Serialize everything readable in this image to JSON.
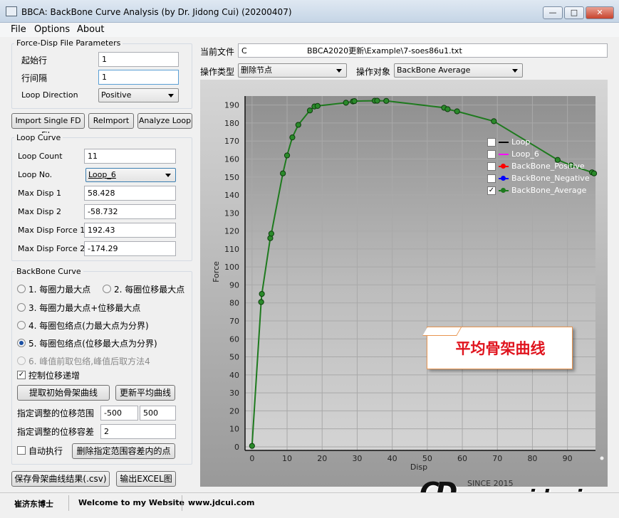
{
  "window": {
    "title": "BBCA: BackBone Curve Analysis (by Dr. Jidong Cui) (20200407)",
    "min": "—",
    "max": "□",
    "close": "✕"
  },
  "menu": [
    "File",
    "Options",
    "About"
  ],
  "fd_params": {
    "title": "Force-Disp File Parameters",
    "start_row_label": "起始行",
    "start_row": "1",
    "row_interval_label": "行间隔",
    "row_interval": "1",
    "loop_direction_label": "Loop Direction",
    "loop_direction": "Positive"
  },
  "buttons": {
    "import": "Import Single FD File",
    "reimport": "ReImport",
    "analyze": "Analyze Loop"
  },
  "loop_curve": {
    "title": "Loop Curve",
    "loop_count_label": "Loop Count",
    "loop_count": "11",
    "loop_no_label": "Loop No.",
    "loop_no": "Loop_6",
    "max_disp1_label": "Max Disp 1",
    "max_disp1": "58.428",
    "max_disp2_label": "Max Disp 2",
    "max_disp2": "-58.732",
    "max_force1_label": "Max Disp Force 1",
    "max_force1": "192.43",
    "max_force2_label": "Max Disp Force 2",
    "max_force2": "-174.29"
  },
  "backbone": {
    "title": "BackBone Curve",
    "opt1": "1. 每圈力最大点",
    "opt2": "2. 每圈位移最大点",
    "opt3": "3. 每圈力最大点+位移最大点",
    "opt4": "4. 每圈包络点(力最大点为分界)",
    "opt5": "5. 每圈包络点(位移最大点为分界)",
    "opt6": "6. 峰值前取包络,峰值后取方法4",
    "control_disp": "控制位移递增",
    "control_disp_checked": "✓",
    "extract_btn": "提取初始骨架曲线",
    "update_btn": "更新平均曲线",
    "range_label": "指定调整的位移范围",
    "range_min": "-500",
    "range_max": "500",
    "tol_label": "指定调整的位移容差",
    "tol": "2",
    "auto_exec": "自动执行",
    "delete_btn": "删除指定范围容差内的点"
  },
  "bottom_buttons": {
    "save": "保存骨架曲线结果(.csv)",
    "excel": "输出EXCEL图"
  },
  "file": {
    "label": "当前文件",
    "path_prefix": "C",
    "path": "BBCA2020更新\\Example\\7-soes86u1.txt"
  },
  "operation": {
    "type_label": "操作类型",
    "type_value": "删除节点",
    "target_label": "操作对象",
    "target_value": "BackBone Average"
  },
  "legend": [
    {
      "name": "Loop",
      "checked": "",
      "color": "#000000"
    },
    {
      "name": "Loop_6",
      "checked": "",
      "color": "#ff00ff"
    },
    {
      "name": "BackBone_Positive",
      "checked": "",
      "color": "#ff0000"
    },
    {
      "name": "BackBone_Negative",
      "checked": "",
      "color": "#0000ff"
    },
    {
      "name": "BackBone_Average",
      "checked": "✓",
      "color": "#1e7a1e"
    }
  ],
  "chart_data": {
    "type": "line",
    "xlabel": "Disp",
    "ylabel": "Force",
    "xlim": [
      -2,
      98
    ],
    "ylim": [
      -2,
      195
    ],
    "xticks": [
      0,
      10,
      20,
      30,
      40,
      50,
      60,
      70,
      80,
      90
    ],
    "yticks": [
      0,
      10,
      20,
      30,
      40,
      50,
      60,
      70,
      80,
      90,
      100,
      110,
      120,
      130,
      140,
      150,
      160,
      170,
      180,
      190
    ],
    "series": [
      {
        "name": "BackBone_Average",
        "color": "#1e7a1e",
        "x": [
          0,
          2.6,
          2.8,
          5.2,
          5.5,
          8.8,
          10.0,
          11.5,
          13.2,
          16.5,
          17.8,
          18.7,
          26.8,
          28.8,
          29.2,
          35.0,
          35.7,
          38.3,
          54.8,
          55.8,
          58.5,
          69.0,
          87.2,
          91.0,
          97.0,
          97.6
        ],
        "y": [
          0.5,
          80.5,
          85,
          116,
          118.5,
          152,
          162,
          172,
          179,
          187,
          189.2,
          189.5,
          191.3,
          192,
          192.2,
          192.4,
          192.4,
          192.3,
          188.5,
          187.7,
          186.5,
          181,
          159.5,
          156.5,
          152.6,
          152
        ]
      }
    ]
  },
  "callout": "平均骨架曲线",
  "watermark": {
    "since": "SINCE 2015",
    "logo": "CD",
    "url": "www.jdcui.com"
  },
  "status": {
    "author": "崔济东博士",
    "welcome": "Welcome to my Website",
    "site": "www.jdcui.com"
  }
}
